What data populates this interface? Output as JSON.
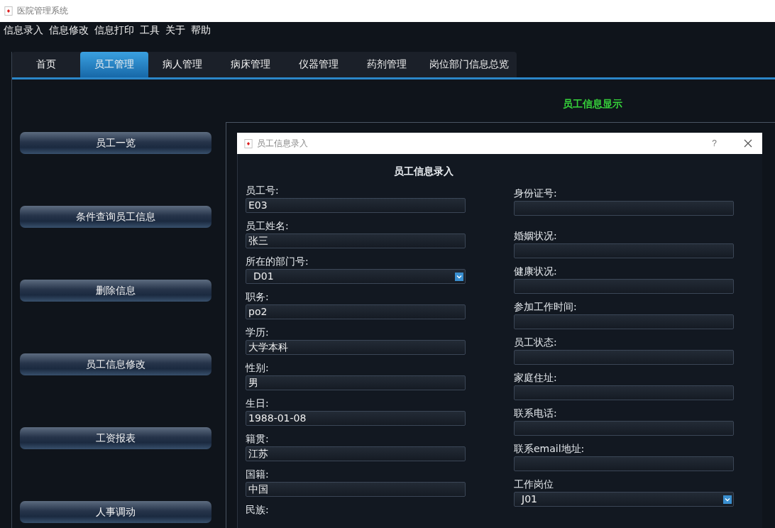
{
  "window": {
    "title": "医院管理系统"
  },
  "menu": [
    "信息录入",
    "信息修改",
    "信息打印",
    "工具",
    "关于",
    "帮助"
  ],
  "tabs": [
    {
      "label": "首页",
      "selected": false
    },
    {
      "label": "员工管理",
      "selected": true
    },
    {
      "label": "病人管理",
      "selected": false
    },
    {
      "label": "病床管理",
      "selected": false
    },
    {
      "label": "仪器管理",
      "selected": false
    },
    {
      "label": "药剂管理",
      "selected": false
    },
    {
      "label": "岗位部门信息总览",
      "selected": false
    }
  ],
  "side_buttons": [
    "员工一览",
    "条件查询员工信息",
    "删除信息",
    "员工信息修改",
    "工资报表",
    "人事调动"
  ],
  "panel_title": "员工信息显示",
  "dialog": {
    "title": "员工信息录入",
    "help": "?",
    "heading": "员工信息录入",
    "left_fields": [
      {
        "label": "员工号:",
        "kind": "text",
        "value": "E03"
      },
      {
        "label": "员工姓名:",
        "kind": "text",
        "value": "张三"
      },
      {
        "label": "所在的部门号:",
        "kind": "select",
        "value": "D01"
      },
      {
        "label": "职务:",
        "kind": "text",
        "value": "po2"
      },
      {
        "label": "学历:",
        "kind": "text",
        "value": "大学本科"
      },
      {
        "label": "性别:",
        "kind": "text",
        "value": "男"
      },
      {
        "label": "生日:",
        "kind": "text",
        "value": "1988-01-08"
      },
      {
        "label": "籍贯:",
        "kind": "text",
        "value": "江苏"
      },
      {
        "label": "国籍:",
        "kind": "text",
        "value": "中国"
      },
      {
        "label": "民族:",
        "kind": "label"
      }
    ],
    "right_fields": [
      {
        "label": "身份证号:",
        "kind": "text"
      },
      {
        "label": "婚姻状况:",
        "kind": "text"
      },
      {
        "label": "健康状况:",
        "kind": "text"
      },
      {
        "label": "参加工作时间:",
        "kind": "text"
      },
      {
        "label": "员工状态:",
        "kind": "text"
      },
      {
        "label": "家庭住址:",
        "kind": "text"
      },
      {
        "label": "联系电话:",
        "kind": "text"
      },
      {
        "label": "联系email地址:",
        "kind": "text"
      },
      {
        "label": "工作岗位",
        "kind": "select",
        "value": "J01"
      }
    ]
  }
}
